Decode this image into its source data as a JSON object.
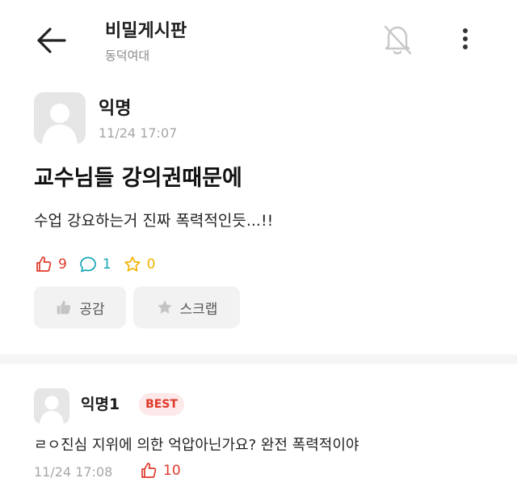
{
  "header": {
    "title": "비밀게시판",
    "subtitle": "동덕여대",
    "back_icon": "arrow-left-icon",
    "notify_icon": "bell-off-icon",
    "more_icon": "more-vertical-icon"
  },
  "post": {
    "author": "익명",
    "time": "11/24 17:07",
    "title": "교수님들 강의권때문에",
    "body": "수업 강요하는거 진짜 폭력적인듯...!!",
    "likes": "9",
    "comments": "1",
    "scraps": "0",
    "like_button_label": "공감",
    "scrap_button_label": "스크랩"
  },
  "comment": {
    "author": "익명1",
    "badge": "BEST",
    "body": "ㄹㅇ진심 지위에 의한 억압아닌가요? 완전 폭력적이야",
    "time": "11/24 17:08",
    "likes": "10"
  },
  "colors": {
    "like": "#e0392b",
    "comment": "#17a5b6",
    "scrap": "#f2b200",
    "badge_bg": "#fde9e9"
  }
}
